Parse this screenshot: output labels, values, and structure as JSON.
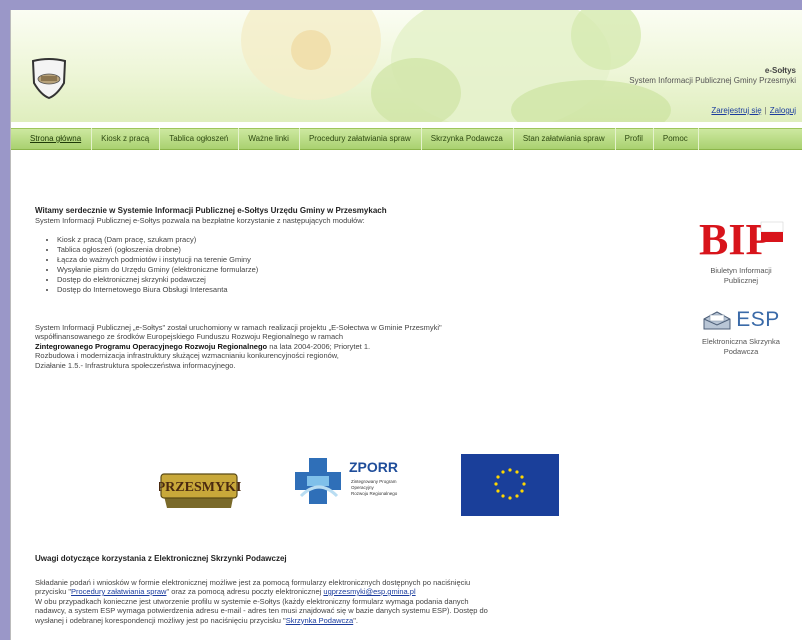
{
  "header": {
    "brand_name": "e-Sołtys",
    "brand_sub": "System Informacji Publicznej Gminy Przesmyki",
    "register_link": "Zarejestruj się",
    "separator": "|",
    "login_link": "Zaloguj"
  },
  "nav": {
    "items": [
      "Strona główna",
      "Kiosk z pracą",
      "Tablica ogłoszeń",
      "Ważne linki",
      "Procedury załatwiania spraw",
      "Skrzynka Podawcza",
      "Stan załatwiania spraw",
      "Profil",
      "Pomoc"
    ]
  },
  "main": {
    "heading": "Witamy serdecznie w Systemie Informacji Publicznej e-Sołtys Urzędu Gminy w Przesmykach",
    "intro": "System Informacji Publicznej e-Sołtys pozwala na bezpłatne korzystanie z następujących modułów:",
    "modules": [
      "Kiosk z pracą (Dam pracę, szukam pracy)",
      "Tablica ogłoszeń (ogłoszenia drobne)",
      "Łącza do ważnych podmiotów i instytucji na terenie Gminy",
      "Wysyłanie pism do Urzędu Gminy (elektroniczne formularze)",
      "Dostęp do elektronicznej skrzynki podawczej",
      "Dostęp do Internetowego Biura Obsługi Interesanta"
    ],
    "para_line1": "System Informacji Publicznej „e-Sołtys\" został uruchomiony w ramach realizacji projektu „E-Sołectwa w Gminie Przesmyki\"",
    "para_line2": "współfinansowanego ze środków Europejskiego Funduszu Rozwoju Regionalnego w ramach",
    "para_line3_bold": "Zintegrowanego Programu Operacyjnego Rozwoju Regionalnego",
    "para_line3_rest": " na lata 2004-2006; Priorytet 1.",
    "para_line4": "Rozbudowa i modernizacja infrastruktury służącej wzmacnianiu konkurencyjności regionów,",
    "para_line5": "Działanie 1.5.- Infrastruktura społeczeństwa informacyjnego."
  },
  "logos": {
    "przesmyki": "PRZESMYKI",
    "zporr_title": "ZPORR",
    "zporr_sub1": "Zintegrowany Program",
    "zporr_sub2": "Operacyjny",
    "zporr_sub3": "Rozwoju Regionalnego"
  },
  "section2": {
    "heading": "Uwagi dotyczące korzystania z Elektronicznej Skrzynki Podawczej",
    "l1": "Składanie podań i wniosków w formie elektronicznej możliwe jest za pomocą formularzy elektronicznych dostępnych po naciśnięciu",
    "l2_pre": "przycisku \"",
    "l2_link": "Procedury załatwiania spraw",
    "l2_mid": "\" oraz za pomocą adresu poczty elektronicznej ",
    "l2_email": "ugprzesmyki@esp.gmina.pl",
    "l3": "W obu przypadkach konieczne jest utworzenie profilu w systemie e-Sołtys (każdy elektroniczny formularz wymaga podania danych",
    "l4": "nadawcy, a system ESP wymaga potwierdzenia adresu e-mail - adres ten musi znajdować się w bazie danych systemu ESP). Dostęp do",
    "l5_pre": "wysłanej i odebranej korespondencji możliwy jest po naciśnięciu przycisku \"",
    "l5_link": "Skrzynka Podawcza",
    "l5_post": "\"."
  },
  "sidebar": {
    "bip_text": "BIP",
    "bip_caption_1": "Biuletyn Informacji",
    "bip_caption_2": "Publicznej",
    "esp_text": "ESP",
    "esp_caption_1": "Elektroniczna Skrzynka",
    "esp_caption_2": "Podawcza"
  },
  "colors": {
    "page_background": "#9a97c8",
    "nav_green": "#a9d170",
    "link_blue": "#1b3c9e",
    "bip_red": "#d8141b",
    "eu_blue": "#1a3f9a",
    "eu_star": "#ffd700"
  }
}
